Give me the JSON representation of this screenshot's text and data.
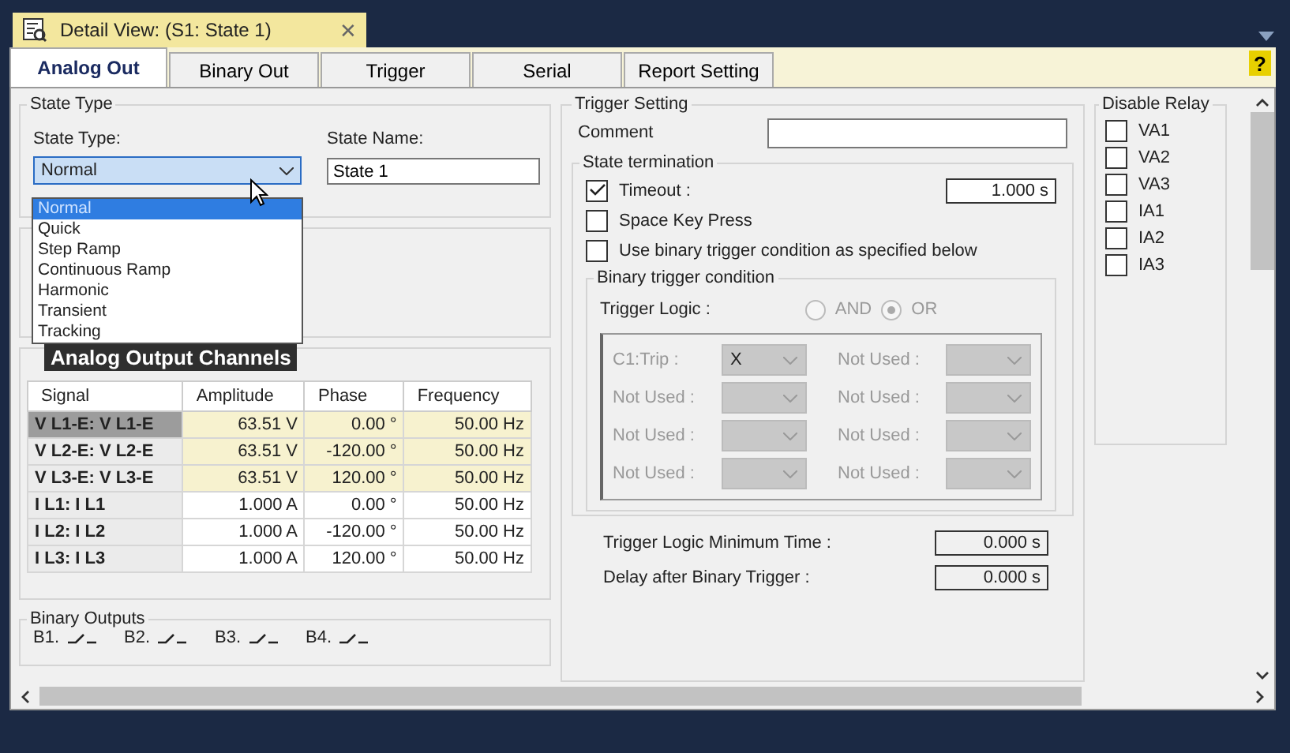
{
  "window": {
    "title": "Detail View: (S1: State 1)",
    "close": "✕",
    "help": "?"
  },
  "tabs": [
    {
      "label": "Analog Out",
      "selected": true
    },
    {
      "label": "Binary Out",
      "selected": false
    },
    {
      "label": "Trigger",
      "selected": false
    },
    {
      "label": "Serial",
      "selected": false
    },
    {
      "label": "Report Setting",
      "selected": false
    }
  ],
  "state_type": {
    "group_title": "State Type",
    "type_label": "State Type:",
    "type_value": "Normal",
    "name_label": "State Name:",
    "name_value": "State 1",
    "options": [
      {
        "label": "Normal",
        "selected": true
      },
      {
        "label": "Quick",
        "selected": false
      },
      {
        "label": "Step Ramp",
        "selected": false
      },
      {
        "label": "Continuous Ramp",
        "selected": false
      },
      {
        "label": "Harmonic",
        "selected": false
      },
      {
        "label": "Transient",
        "selected": false
      },
      {
        "label": "Tracking",
        "selected": false
      }
    ]
  },
  "channels": {
    "title": "Analog Output Channels",
    "columns": [
      "Signal",
      "Amplitude",
      "Phase",
      "Frequency"
    ],
    "rows": [
      {
        "signal": "V L1-E: V L1-E",
        "amplitude": "63.51 V",
        "phase": "0.00 °",
        "frequency": "50.00 Hz",
        "highlighted": true,
        "selected": true
      },
      {
        "signal": "V L2-E: V L2-E",
        "amplitude": "63.51 V",
        "phase": "-120.00 °",
        "frequency": "50.00 Hz",
        "highlighted": true,
        "selected": false
      },
      {
        "signal": "V L3-E: V L3-E",
        "amplitude": "63.51 V",
        "phase": "120.00 °",
        "frequency": "50.00 Hz",
        "highlighted": true,
        "selected": false
      },
      {
        "signal": "I L1: I L1",
        "amplitude": "1.000 A",
        "phase": "0.00 °",
        "frequency": "50.00 Hz",
        "highlighted": false,
        "selected": false
      },
      {
        "signal": "I L2: I L2",
        "amplitude": "1.000 A",
        "phase": "-120.00 °",
        "frequency": "50.00 Hz",
        "highlighted": false,
        "selected": false
      },
      {
        "signal": "I L3: I L3",
        "amplitude": "1.000 A",
        "phase": "120.00 °",
        "frequency": "50.00 Hz",
        "highlighted": false,
        "selected": false
      }
    ]
  },
  "binary_outputs": {
    "title": "Binary Outputs",
    "items": [
      "B1.",
      "B2.",
      "B3.",
      "B4."
    ]
  },
  "trigger": {
    "title": "Trigger Setting",
    "comment_label": "Comment",
    "termination_title": "State termination",
    "conditions": [
      {
        "label": "Timeout :",
        "checked": true,
        "value": "1.000 s"
      },
      {
        "label": "Space Key Press",
        "checked": false
      },
      {
        "label": "Use binary trigger condition as specified below",
        "checked": false
      }
    ],
    "binary": {
      "title": "Binary trigger condition",
      "disabled": true,
      "logic_label": "Trigger Logic :",
      "logic": [
        {
          "label": "AND",
          "selected": false
        },
        {
          "label": "OR",
          "selected": true
        }
      ],
      "inputs": [
        {
          "label": "C1:Trip :",
          "value": "X"
        },
        {
          "label": "Not Used :"
        },
        {
          "label": "Not Used :"
        },
        {
          "label": "Not Used :"
        },
        {
          "label": "Not Used :"
        },
        {
          "label": "Not Used :"
        },
        {
          "label": "Not Used :"
        },
        {
          "label": "Not Used :"
        }
      ]
    },
    "min_time_label": "Trigger Logic Minimum Time :",
    "min_time_value": "0.000 s",
    "delay_label": "Delay after Binary Trigger :",
    "delay_value": "0.000 s"
  },
  "disable_relay": {
    "title": "Disable Relay",
    "items": [
      {
        "label": "VA1",
        "checked": false
      },
      {
        "label": "VA2",
        "checked": false
      },
      {
        "label": "VA3",
        "checked": false
      },
      {
        "label": "IA1",
        "checked": false
      },
      {
        "label": "IA2",
        "checked": false
      },
      {
        "label": "IA3",
        "checked": false
      }
    ]
  }
}
